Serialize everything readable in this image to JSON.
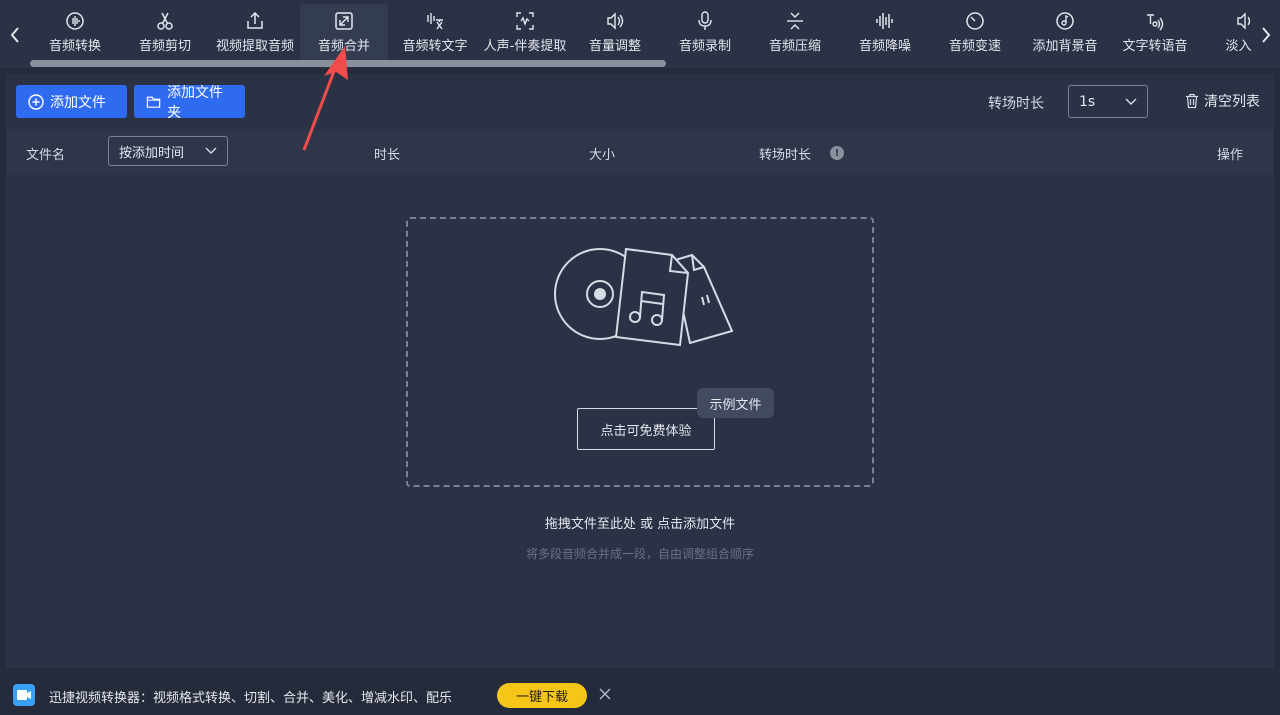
{
  "toolbar": {
    "tools": [
      {
        "label": "音频转换",
        "icon": "audio-convert-icon"
      },
      {
        "label": "音频剪切",
        "icon": "scissors-icon"
      },
      {
        "label": "视频提取音频",
        "icon": "upload-icon"
      },
      {
        "label": "音频合并",
        "icon": "merge-icon",
        "active": true
      },
      {
        "label": "音频转文字",
        "icon": "audio-to-text-icon"
      },
      {
        "label": "人声-伴奏提取",
        "icon": "vocal-extract-icon"
      },
      {
        "label": "音量调整",
        "icon": "volume-icon"
      },
      {
        "label": "音频录制",
        "icon": "microphone-icon"
      },
      {
        "label": "音频压缩",
        "icon": "compress-icon"
      },
      {
        "label": "音频降噪",
        "icon": "waveform-icon"
      },
      {
        "label": "音频变速",
        "icon": "speed-icon"
      },
      {
        "label": "添加背景音",
        "icon": "music-note-icon"
      },
      {
        "label": "文字转语音",
        "icon": "text-to-speech-icon"
      },
      {
        "label": "淡入淡",
        "icon": "fade-icon"
      }
    ]
  },
  "actions": {
    "add_file": "添加文件",
    "add_folder": "添加文件夹",
    "transition_label": "转场时长",
    "transition_value": "1s",
    "clear_list": "清空列表"
  },
  "table": {
    "col_filename": "文件名",
    "sort_value": "按添加时间",
    "col_duration": "时长",
    "col_size": "大小",
    "col_transition": "转场时长",
    "col_actions": "操作"
  },
  "dropzone": {
    "try_button": "点击可免费体验",
    "sample_tag": "示例文件",
    "hint": "拖拽文件至此处 或 点击添加文件",
    "sub_hint": "将多段音频合并成一段，自由调整组合顺序"
  },
  "bottom": {
    "promo": "迅捷视频转换器：视频格式转换、切割、合并、美化、增减水印、配乐",
    "download": "一键下载"
  },
  "colors": {
    "background": "#252b3b",
    "panel": "#2b3245",
    "accent_blue": "#2f6bf0",
    "download_yellow": "#f5c518",
    "arrow_red": "#f04c4c"
  }
}
